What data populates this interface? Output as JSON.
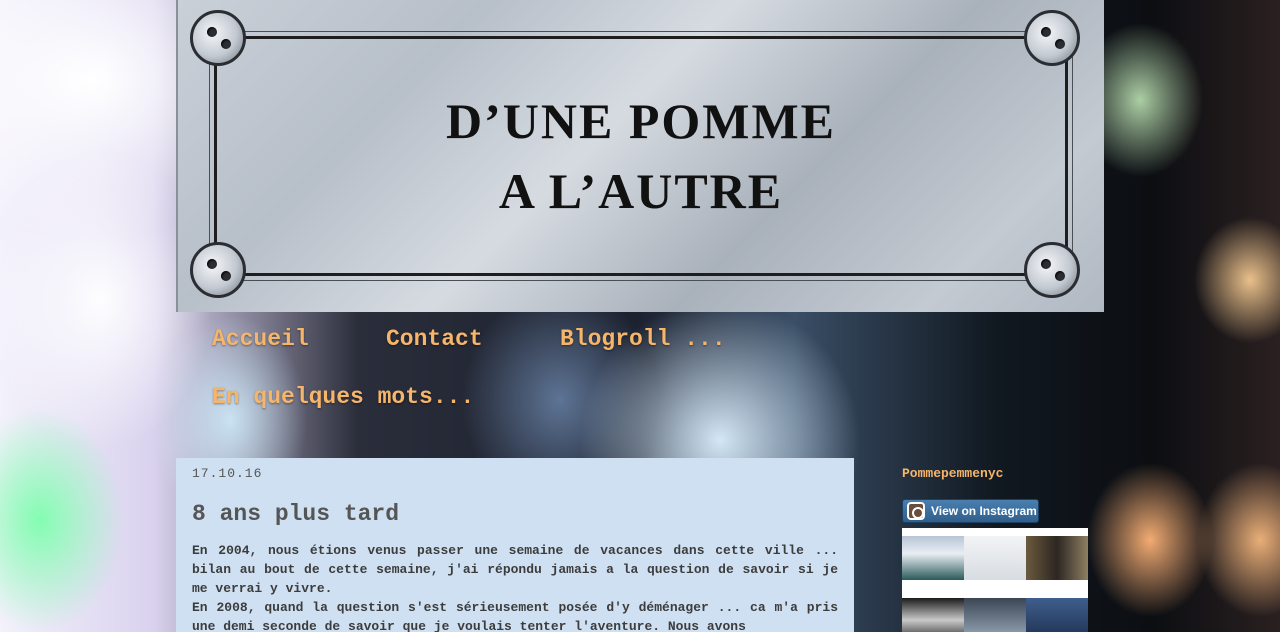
{
  "header": {
    "title_line1": "D’UNE POMME",
    "title_line2": "A L’AUTRE"
  },
  "nav": {
    "items": [
      {
        "label": "Accueil"
      },
      {
        "label": "Contact"
      },
      {
        "label": "Blogroll ..."
      },
      {
        "label": "En quelques mots..."
      }
    ]
  },
  "post": {
    "date": "17.10.16",
    "title": "8 ans plus tard",
    "paragraphs": [
      "En  2004, nous étions venus passer une semaine de vacances dans cette ville ... bilan au bout de cette semaine, j'ai répondu jamais a la question de savoir si je me verrai y vivre.",
      "En 2008, quand la question s'est sérieusement posée d'y déménager ... ca m'a pris une demi seconde de savoir que je voulais tenter l'aventure. Nous avons"
    ]
  },
  "sidebar": {
    "title": "Pommepemmenyc",
    "instagram_button": "View on Instagram"
  },
  "colors": {
    "nav_link": "#f6b56a",
    "post_background": "#cfe0f2"
  }
}
